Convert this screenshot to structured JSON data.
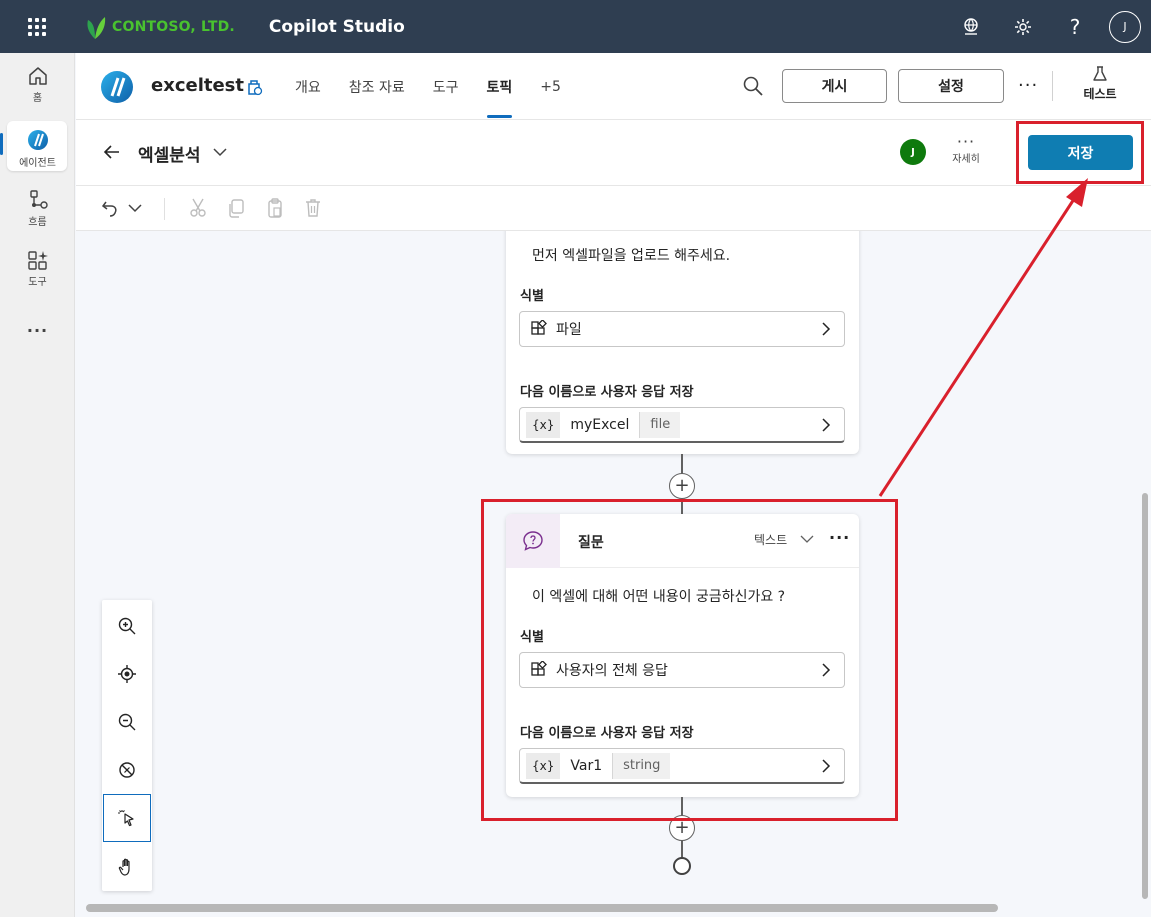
{
  "topbar": {
    "brand": "CONTOSO, LTD.",
    "product": "Copilot Studio",
    "avatar_initial": "J"
  },
  "rail": {
    "items": [
      {
        "label": "홈"
      },
      {
        "label": "에이전트"
      },
      {
        "label": "흐름"
      },
      {
        "label": "도구"
      }
    ]
  },
  "agent": {
    "name": "exceltest",
    "tabs": [
      {
        "label": "개요"
      },
      {
        "label": "참조 자료"
      },
      {
        "label": "도구"
      },
      {
        "label": "토픽",
        "active": true
      },
      {
        "label": "+5"
      }
    ],
    "publish_label": "게시",
    "settings_label": "설정",
    "test_label": "테스트"
  },
  "topic": {
    "name": "엑셀분석",
    "avatar_initial": "J",
    "details_label": "자세히",
    "save_label": "저장"
  },
  "card1": {
    "message": "먼저 엑셀파일을 업로드 해주세요.",
    "identify_label": "식별",
    "identify_value": "파일",
    "save_response_label": "다음 이름으로 사용자 응답 저장",
    "var_badge": "{x}",
    "var_name": "myExcel",
    "var_type": "file"
  },
  "card2": {
    "title": "질문",
    "type_label": "텍스트",
    "message": "이 엑셀에 대해 어떤 내용이 궁금하신가요 ?",
    "identify_label": "식별",
    "identify_value": "사용자의 전체 응답",
    "save_response_label": "다음 이름으로 사용자 응답 저장",
    "var_badge": "{x}",
    "var_name": "Var1",
    "var_type": "string"
  },
  "colors": {
    "topbar": "#2f3e51",
    "save_button": "#0f7db2",
    "annotation": "#d9202c",
    "brand_green": "#49c22f"
  }
}
